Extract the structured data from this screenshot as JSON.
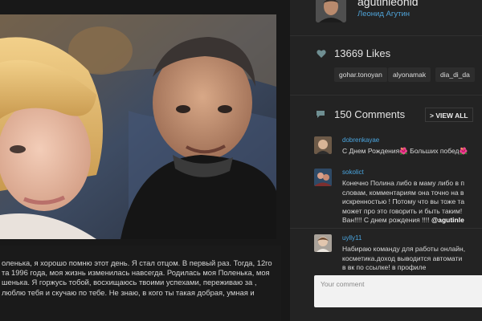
{
  "post": {
    "caption": "оленька, я хорошо помню этот день. Я стал отцом. В первый раз. Тогда, 12го та 1996 года, моя жизнь изменилась навсегда. Родилась моя Поленька, моя шенька. Я горжусь тобой, восхищаюсь твоими успехами, переживаю за , люблю тебя и скучаю по тебе. Не знаю, в кого ты такая добрая, умная и"
  },
  "profile": {
    "username": "agutinleonid",
    "full_name": "Леонид Агутин"
  },
  "likes": {
    "count_text": "13669 Likes",
    "tags": [
      "gohar.tonoyan",
      "alyonamak",
      "dia_di_da"
    ]
  },
  "comments": {
    "count_text": "150 Comments",
    "view_all_label": "> VIEW ALL",
    "items": [
      {
        "user": "dobrenkayae",
        "text": "С Днем Рождения🌺 Больших побед🌺"
      },
      {
        "user": "sokolict",
        "text": "Конечно Полина либо в маму либо в п\nсловам, комментариям она точно на в\nискренностью ! Потому что вы тоже та\nможет про это говорить и быть таким!\nВан!!!! С днем рождения !!!! ",
        "mention": "@agutinle"
      },
      {
        "user": "uylly11",
        "text": "Набираю команду для работы онлайн,\nкосметика.доход выводится автомати\nв вк по ссылке! в профиле"
      }
    ],
    "input_placeholder": "Your comment"
  },
  "colors": {
    "background": "#1b1b1b",
    "sidebar": "#232323",
    "link": "#4aa6e0",
    "icon": "#6f8f92"
  }
}
